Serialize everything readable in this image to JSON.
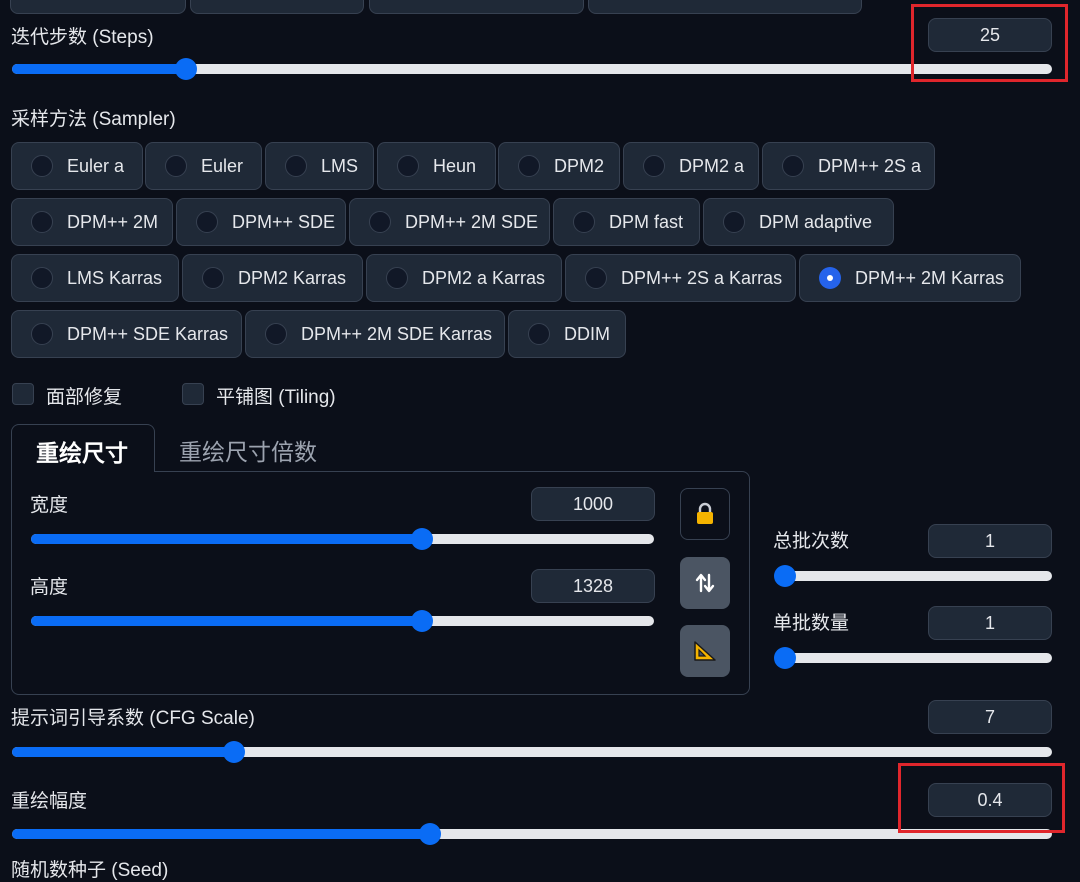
{
  "steps": {
    "label": "迭代步数 (Steps)",
    "value": "25",
    "fraction": 0.155
  },
  "sampler": {
    "label": "采样方法 (Sampler)",
    "options": [
      "Euler a",
      "Euler",
      "LMS",
      "Heun",
      "DPM2",
      "DPM2 a",
      "DPM++ 2S a",
      "DPM++ 2M",
      "DPM++ SDE",
      "DPM++ 2M SDE",
      "DPM fast",
      "DPM adaptive",
      "LMS Karras",
      "DPM2 Karras",
      "DPM2 a Karras",
      "DPM++ 2S a Karras",
      "DPM++ 2M Karras",
      "DPM++ SDE Karras",
      "DPM++ 2M SDE Karras",
      "DDIM"
    ],
    "selected": "DPM++ 2M Karras"
  },
  "checkboxes": {
    "face_restore": "面部修复",
    "tiling": "平铺图 (Tiling)"
  },
  "tabs": {
    "resize": "重绘尺寸",
    "resize_by": "重绘尺寸倍数"
  },
  "width": {
    "label": "宽度",
    "value": "1000",
    "fraction": 0.62
  },
  "height": {
    "label": "高度",
    "value": "1328",
    "fraction": 0.62
  },
  "batch_count": {
    "label": "总批次数",
    "value": "1",
    "fraction": 0.0
  },
  "batch_size": {
    "label": "单批数量",
    "value": "1",
    "fraction": 0.0
  },
  "cfg": {
    "label": "提示词引导系数 (CFG Scale)",
    "value": "7",
    "fraction": 0.21
  },
  "denoise": {
    "label": "重绘幅度",
    "value": "0.4",
    "fraction": 0.4
  },
  "seed": {
    "label": "随机数种子 (Seed)"
  },
  "colors": {
    "accent": "#0a6cf5",
    "highlight": "#e0262c",
    "lock": "#f5b400"
  },
  "icons": [
    "lock-icon",
    "swap-icon",
    "ruler-triangle-icon"
  ]
}
